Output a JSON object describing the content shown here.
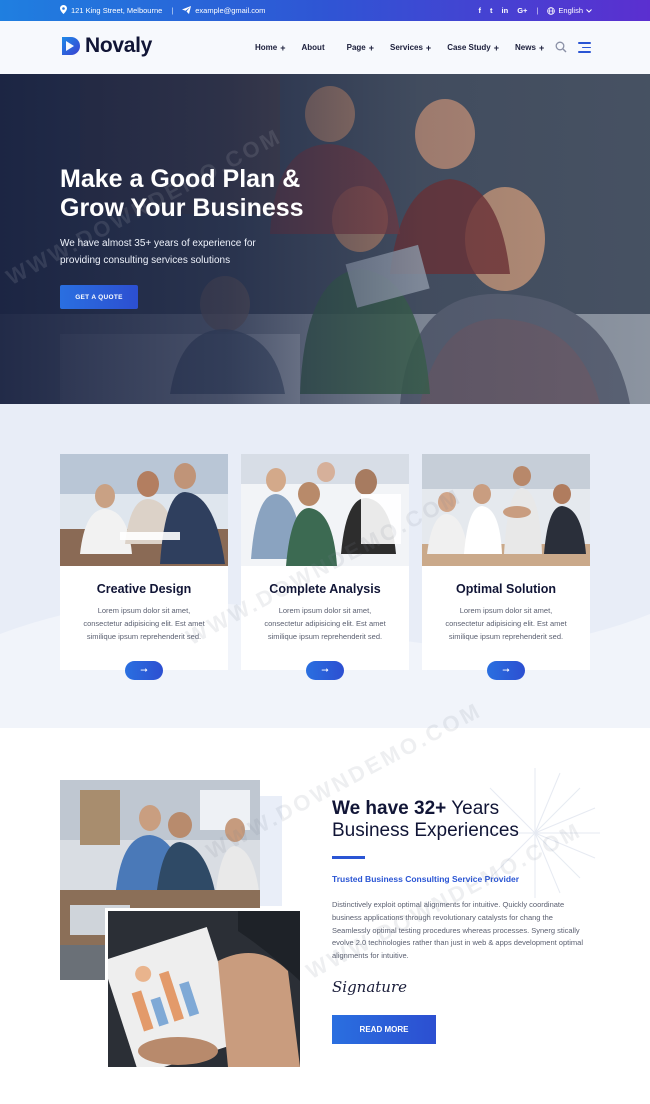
{
  "topbar": {
    "address": "121 King Street, Melbourne",
    "email": "example@gmail.com",
    "social": [
      "f",
      "t",
      "in",
      "G+"
    ],
    "language": "English"
  },
  "header": {
    "logo_text": "Novaly",
    "nav": [
      {
        "label": "Home",
        "has_submenu": true
      },
      {
        "label": "About",
        "has_submenu": false
      },
      {
        "label": "Page",
        "has_submenu": true
      },
      {
        "label": "Services",
        "has_submenu": true
      },
      {
        "label": "Case Study",
        "has_submenu": true
      },
      {
        "label": "News",
        "has_submenu": true
      }
    ]
  },
  "hero": {
    "title_line1": "Make a Good Plan &",
    "title_line2": "Grow Your Business",
    "subtitle_line1": "We have almost 35+ years of experience for",
    "subtitle_line2": "providing consulting services solutions",
    "button": "GET A QUOTE"
  },
  "services": {
    "cards": [
      {
        "title": "Creative Design",
        "text_line1": "Lorem ipsum dolor sit amet,",
        "text_line2": "consectetur adipisicing elit. Est amet",
        "text_line3": "similique ipsum reprehenderit sed.",
        "button": "➞"
      },
      {
        "title": "Complete Analysis",
        "text_line1": "Lorem ipsum dolor sit amet,",
        "text_line2": "consectetur adipisicing elit. Est amet",
        "text_line3": "similique ipsum reprehenderit sed.",
        "button": "➞"
      },
      {
        "title": "Optimal Solution",
        "text_line1": "Lorem ipsum dolor sit amet,",
        "text_line2": "consectetur adipisicing elit. Est amet",
        "text_line3": "similique ipsum reprehenderit sed.",
        "button": "➞"
      }
    ]
  },
  "about": {
    "heading_bold": "We have 32+",
    "heading_rest": " Years",
    "heading_line2": "Business Experiences",
    "subheading": "Trusted Business Consulting Service Provider",
    "paragraph": "Distinctively exploit optimal alignments for intuitive. Quickly coordinate business applications through revolutionary catalysts for chang the Seamlessly optimal testing procedures whereas processes. Synerg stically evolve 2.0 technologies rather than just in web & apps development optimal alignments for intuitive.",
    "signature": "Signature",
    "button": "READ MORE"
  },
  "watermark": "WWW.DOWNDEMO.COM",
  "colors": {
    "primary": "#2a55d4",
    "gradient_start": "#2a6fe0",
    "dark": "#111536"
  }
}
